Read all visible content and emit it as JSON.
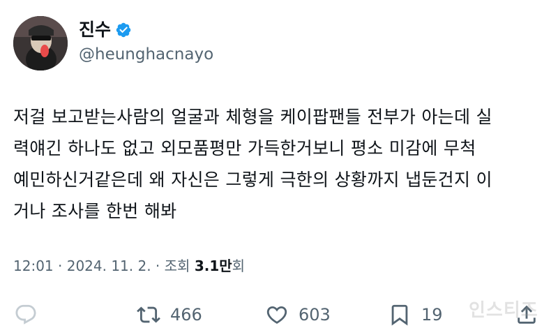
{
  "author": {
    "display_name": "진수",
    "handle": "@heunghacnayo",
    "verified_icon": "verified-badge-icon",
    "verified_color": "#1d9bf0"
  },
  "tweet": {
    "lines": [
      "저걸 보고받는사람의 얼굴과 체형을 케이팝팬들 전부가 아는데 실",
      "력얘긴 하나도 없고 외모품평만 가득한거보니 평소 미감에 무척",
      "예민하신거같은데 왜 자신은 그렇게 극한의 상황까지 냅둔건지 이",
      "거나 조사를 한번 해봐"
    ]
  },
  "meta": {
    "time": "12:01",
    "sep1": " · ",
    "date": "2024. 11. 2.",
    "sep2": " · ",
    "views_label": "조회 ",
    "views_count": "3.1만",
    "views_suffix": "회"
  },
  "actions": {
    "reply_icon": "reply-icon",
    "retweet_icon": "retweet-icon",
    "retweet_count": "466",
    "like_icon": "heart-icon",
    "like_count": "603",
    "bookmark_icon": "bookmark-icon",
    "bookmark_count": "19",
    "share_icon": "share-icon"
  },
  "watermark": "인스티즈",
  "colors": {
    "text": "#0f1419",
    "secondary": "#536471",
    "background": "#ffffff"
  }
}
